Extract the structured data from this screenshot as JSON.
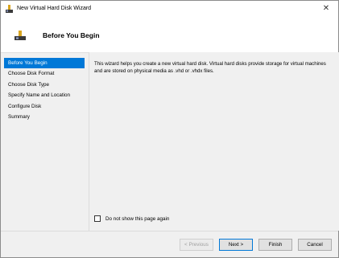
{
  "window": {
    "title": "New Virtual Hard Disk Wizard",
    "close_glyph": "✕"
  },
  "header": {
    "title": "Before You Begin"
  },
  "nav": {
    "items": [
      {
        "label": "Before You Begin",
        "active": true
      },
      {
        "label": "Choose Disk Format"
      },
      {
        "label": "Choose Disk Type"
      },
      {
        "label": "Specify Name and Location"
      },
      {
        "label": "Configure Disk"
      },
      {
        "label": "Summary"
      }
    ]
  },
  "content": {
    "description": "This wizard helps you create a new virtual hard disk. Virtual hard disks provide storage for virtual machines and are stored on physical media as .vhd or .vhdx files.",
    "checkbox_label": "Do not show this page again",
    "checkbox_checked": false
  },
  "buttons": {
    "previous": "< Previous",
    "next": "Next >",
    "finish": "Finish",
    "cancel": "Cancel"
  },
  "colors": {
    "accent": "#0078d7"
  },
  "icons": {
    "title": "disk-icon",
    "header": "disk-icon",
    "close": "close-icon"
  }
}
